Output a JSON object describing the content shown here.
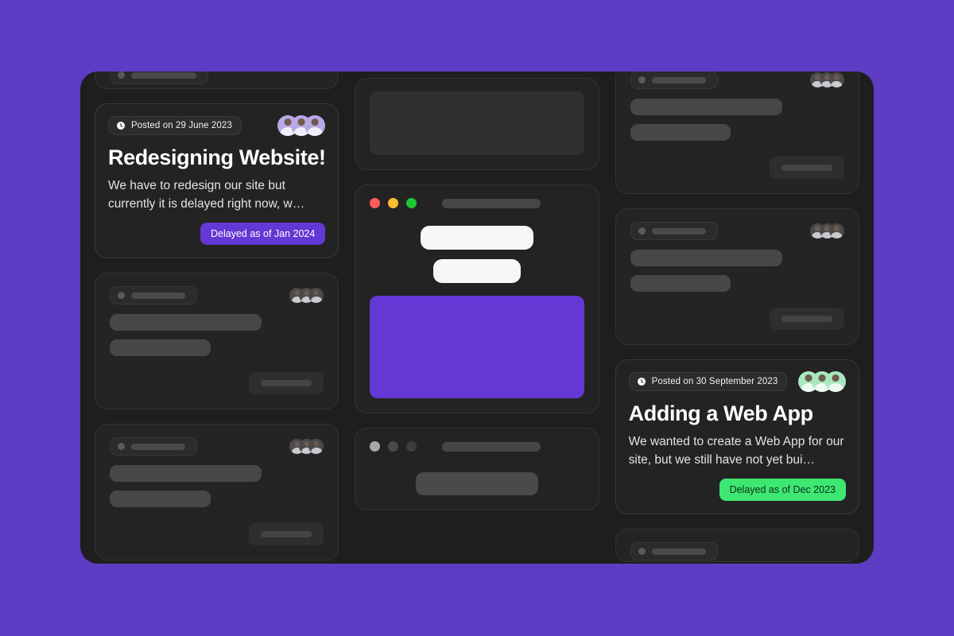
{
  "background_color": "#5e3cc4",
  "window": {
    "background_color": "#1e1e1e"
  },
  "columns": {
    "left": {
      "cards": [
        {
          "type": "skeleton-clipped-top"
        },
        {
          "type": "featured",
          "posted_label": "Posted on 29 June 2023",
          "clock_icon": "clock-icon",
          "title": "Redesigning Website!",
          "body": "We have to redesign our site but currently it is  delayed right now, w…",
          "badge_label": "Delayed as of Jan 2024",
          "badge_color": "#6338d4",
          "badge_text_color": "#ffffff",
          "avatar_count": 3,
          "avatar_tint": "purple"
        },
        {
          "type": "skeleton",
          "avatar_count": 3,
          "avatar_tint": "dim"
        },
        {
          "type": "skeleton",
          "avatar_count": 3,
          "avatar_tint": "dim"
        }
      ]
    },
    "middle": {
      "cards": [
        {
          "type": "grey-panel"
        },
        {
          "type": "browser",
          "dots": [
            "#fc5b5b",
            "#fcbc2e",
            "#1fc832"
          ],
          "accent_block_color": "#6338d4"
        },
        {
          "type": "browser-muted",
          "dots": [
            "#a8a8a8",
            "#4a4a4a",
            "#3c3c3c"
          ]
        }
      ]
    },
    "right": {
      "cards": [
        {
          "type": "skeleton-clipped-top",
          "avatar_count": 3,
          "avatar_tint": "dim"
        },
        {
          "type": "skeleton",
          "avatar_count": 3,
          "avatar_tint": "dim"
        },
        {
          "type": "featured",
          "posted_label": "Posted on 30 September 2023",
          "clock_icon": "clock-icon",
          "title": "Adding a Web App",
          "body": "We wanted to create a Web App for our site, but we still have not yet bui…",
          "badge_label": "Delayed as of Dec 2023",
          "badge_color": "#3ce772",
          "badge_text_color": "#0e2d18",
          "avatar_count": 3,
          "avatar_tint": "green"
        },
        {
          "type": "skeleton-clipped-bottom"
        }
      ]
    }
  }
}
